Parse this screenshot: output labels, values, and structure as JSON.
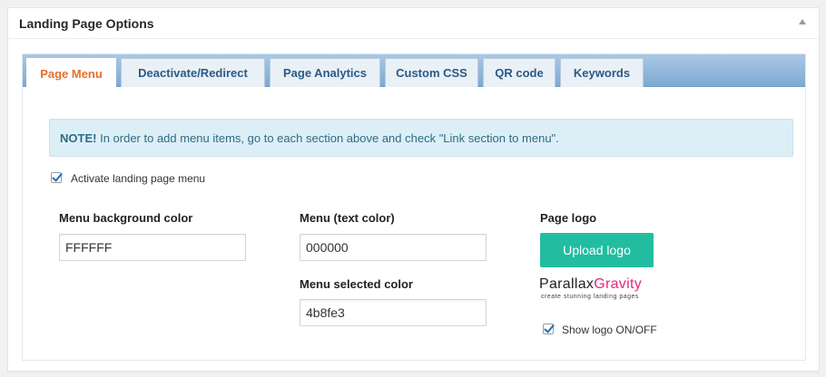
{
  "box": {
    "title": "Landing Page Options"
  },
  "tabs": [
    {
      "label": "Page Menu",
      "active": true
    },
    {
      "label": "Deactivate/Redirect",
      "active": false
    },
    {
      "label": "Page Analytics",
      "active": false
    },
    {
      "label": "Custom CSS",
      "active": false
    },
    {
      "label": "QR code",
      "active": false
    },
    {
      "label": "Keywords",
      "active": false
    }
  ],
  "notice": {
    "strong": "NOTE!",
    "text": "In order to add menu items, go to each section above and check \"Link section to menu\"."
  },
  "activate_menu": {
    "label": "Activate landing page menu",
    "checked": true
  },
  "fields": {
    "bg_color": {
      "label": "Menu background color",
      "value": "FFFFFF"
    },
    "text_color": {
      "label": "Menu (text color)",
      "value": "000000"
    },
    "selected_color": {
      "label": "Menu selected color",
      "value": "4b8fe3"
    }
  },
  "logo_section": {
    "label": "Page logo",
    "upload_button": "Upload logo",
    "logo_text_part1": "Parallax",
    "logo_text_part2": "Gravity",
    "logo_tagline": "create stunning landing pages",
    "show_logo_label": "Show logo ON/OFF",
    "show_logo_checked": true
  },
  "colors": {
    "active_tab": "#e56f2b",
    "tab_text": "#2a5a86",
    "button": "#22bda1",
    "notice_bg": "#ddeff6",
    "logo_accent": "#e6267f"
  }
}
